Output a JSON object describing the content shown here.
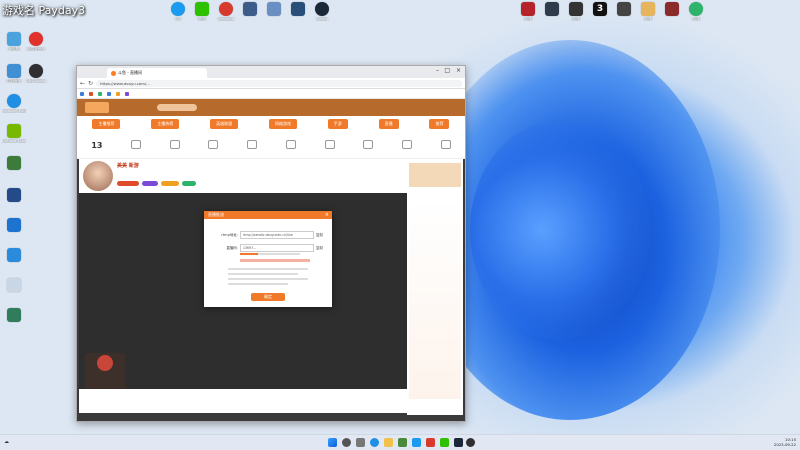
{
  "stream_overlay": {
    "title": "游戏名 Payday3"
  },
  "desktop_icons_left": [
    {
      "label": "此电脑",
      "color": "#4aa3df",
      "icon": "computer-icon"
    },
    {
      "label": "网易云音乐",
      "color": "#e0312b",
      "icon": "netease-music-icon"
    },
    {
      "label": "控制面板",
      "color": "#3f8fd2",
      "icon": "control-panel-icon"
    },
    {
      "label": "Microsoft Edge",
      "color": "#1f8ee5",
      "icon": "edge-icon"
    },
    {
      "label": "GeForce Experience",
      "color": "#76b900",
      "icon": "nvidia-icon"
    },
    {
      "label": "OBS Studio",
      "color": "#302e31",
      "icon": "obs-icon"
    }
  ],
  "desktop_icons_top": [
    {
      "label": "QQ",
      "color": "#1a9bf0",
      "icon": "qq-icon"
    },
    {
      "label": "微信",
      "color": "#2dc100",
      "icon": "wechat-icon"
    },
    {
      "label": "WeGame",
      "color": "#d83a2e",
      "icon": "wegame-icon"
    },
    {
      "label": "Steam",
      "color": "#1b2838",
      "icon": "steam-icon"
    }
  ],
  "desktop_icons_right": [
    {
      "label": "游戏",
      "color": "#b5242a",
      "icon": "game-icon"
    },
    {
      "label": "游戏",
      "color": "#333333",
      "icon": "game-icon"
    },
    {
      "label": "3",
      "color": "#111111",
      "icon": "game-icon"
    },
    {
      "label": "游戏",
      "color": "#e6b45a",
      "icon": "game-icon"
    },
    {
      "label": "游戏",
      "color": "#2db36a",
      "icon": "game-icon"
    }
  ],
  "browser": {
    "tab_title": "斗鱼 - 直播间",
    "url": "https://www.douyu.com/..."
  },
  "site": {
    "categories": [
      "主播推荐",
      "主播热榜",
      "英雄联盟",
      "网络游戏",
      "手游",
      "直播",
      "推荐"
    ],
    "date_day": "13",
    "room_title": "美美 新游"
  },
  "dialog": {
    "title": "直播推流",
    "close_label": "×",
    "rows": [
      {
        "label": "rtmp地址:",
        "value": "rtmp://sendtc.douyucdn.cn/live",
        "copy": "复制"
      },
      {
        "label": "直播码:",
        "value": "13697...",
        "copy": "复制"
      }
    ],
    "confirm_label": "确定"
  },
  "taskbar": {
    "time": "10:15",
    "date": "2023-09-22"
  }
}
